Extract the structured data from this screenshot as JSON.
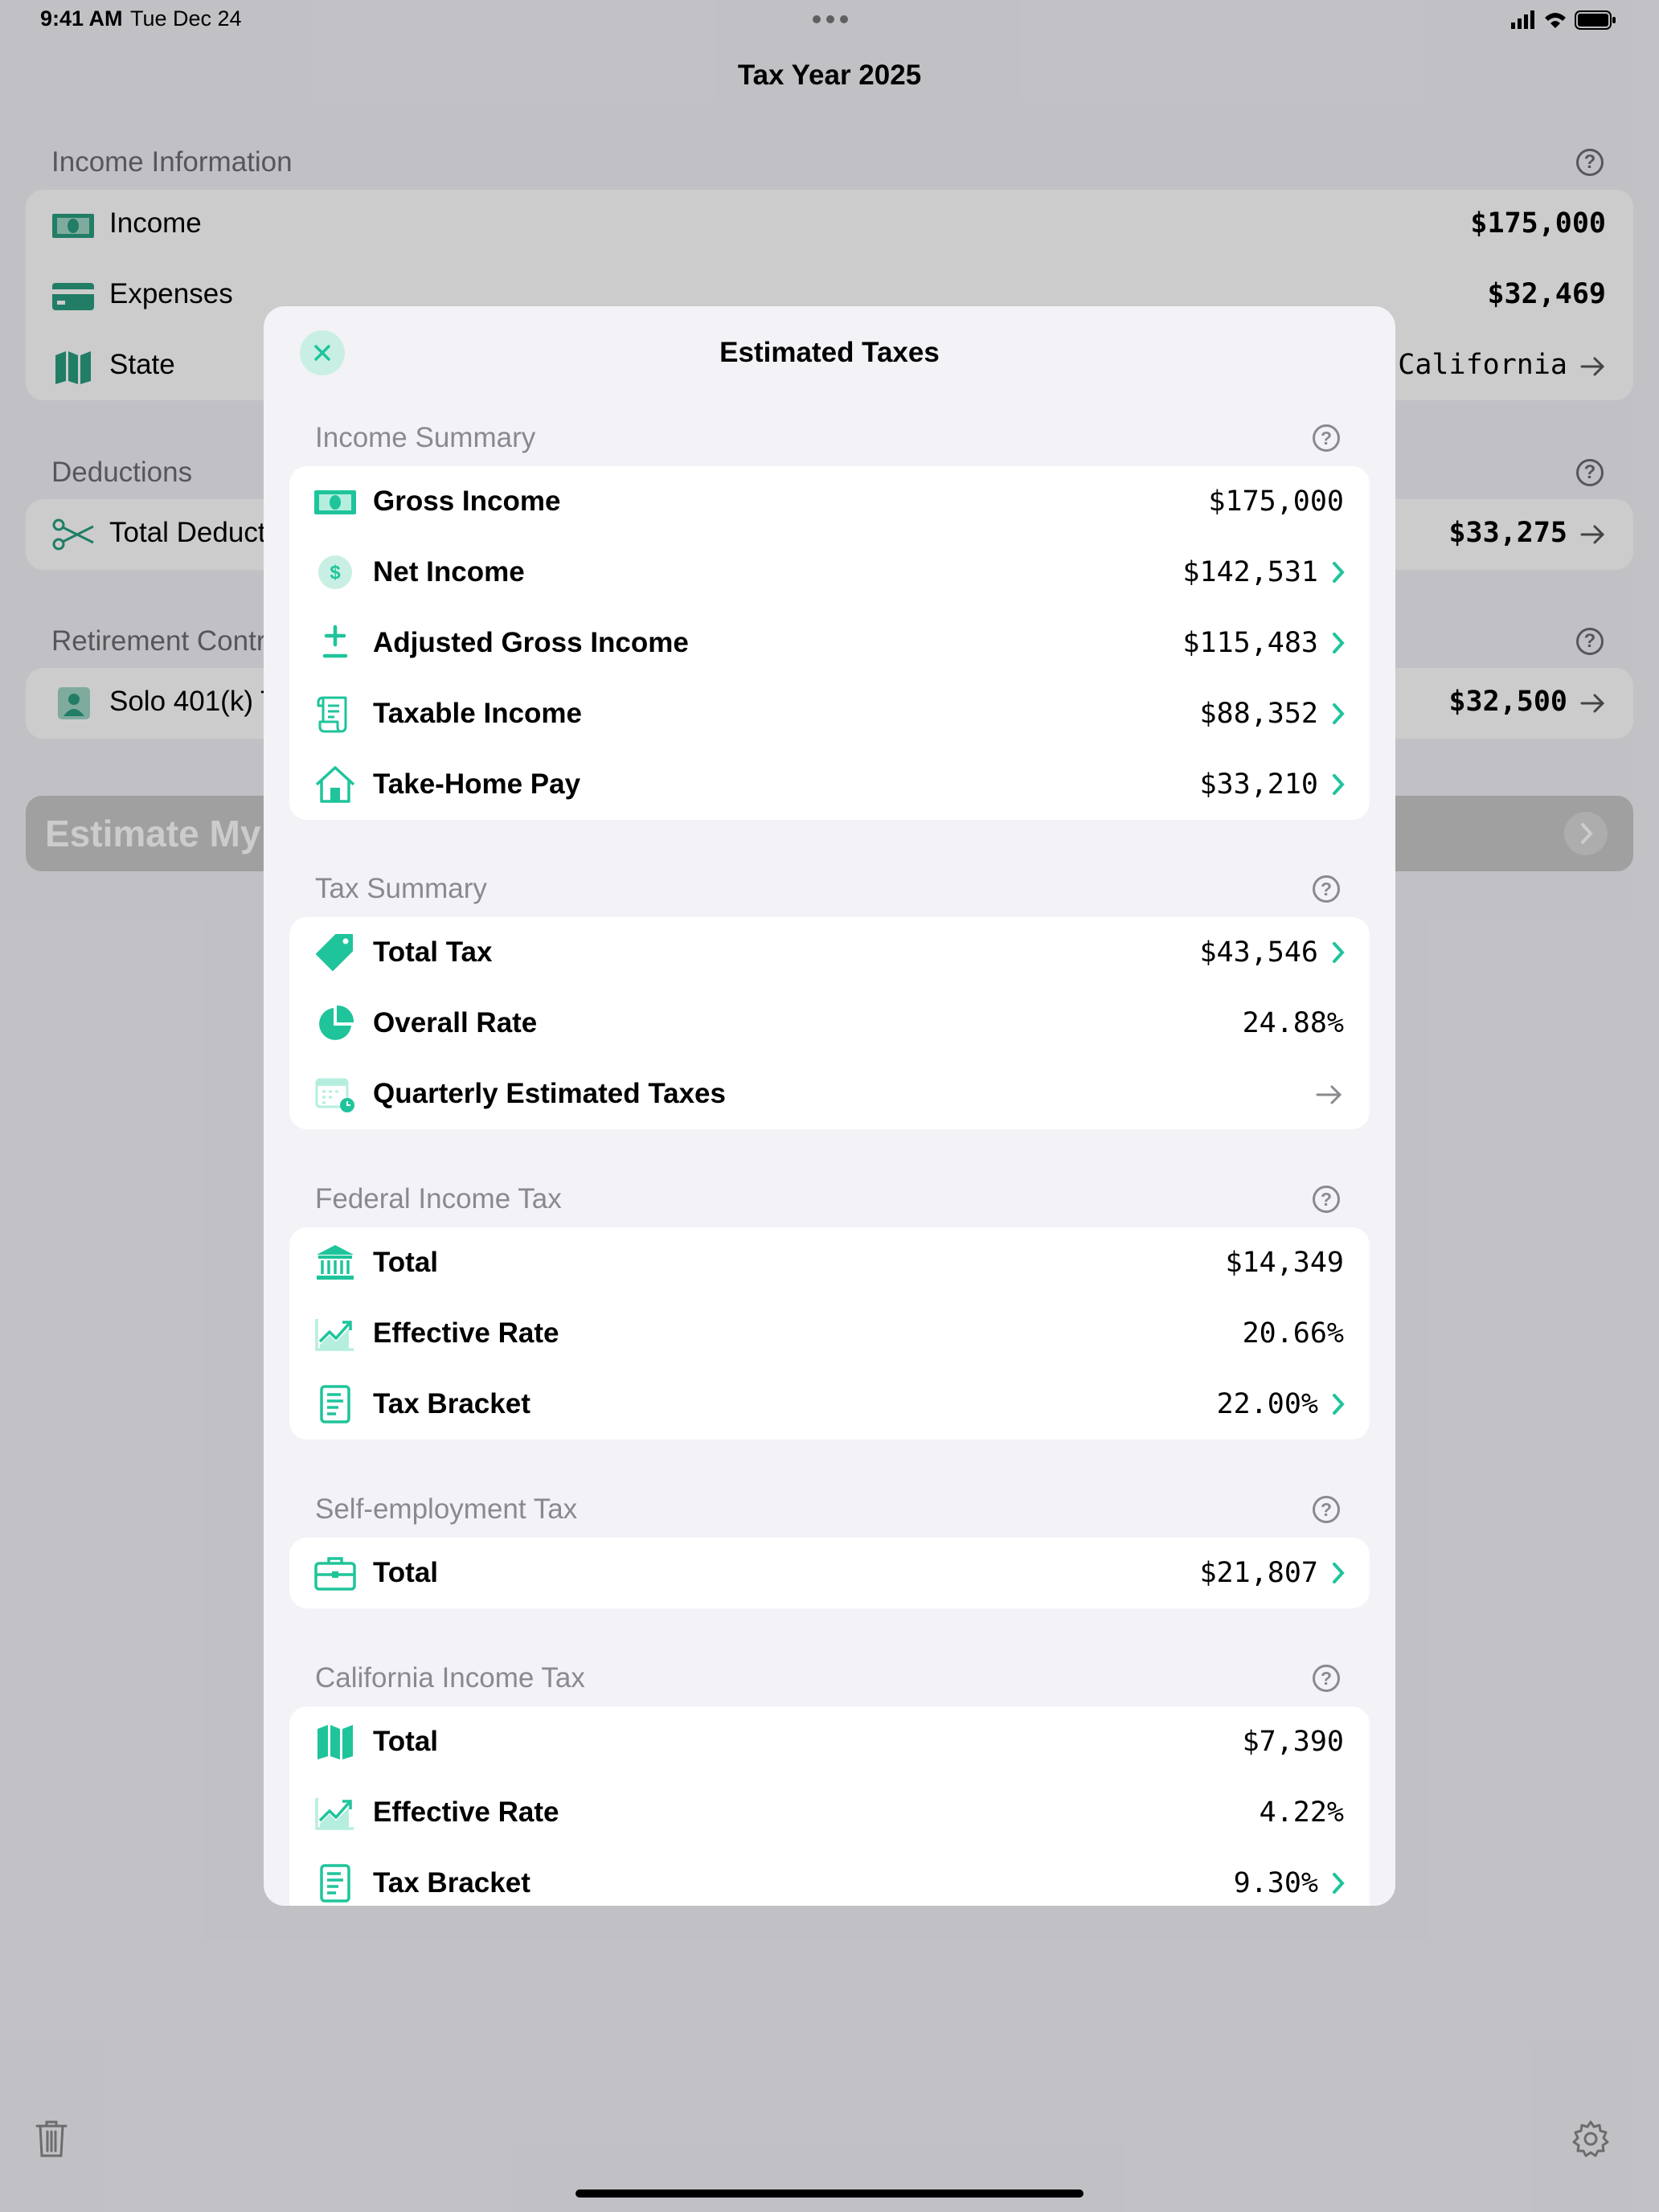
{
  "status_bar": {
    "time": "9:41 AM",
    "date": "Tue Dec 24"
  },
  "nav": {
    "title": "Tax Year 2025"
  },
  "background": {
    "income_header": "Income Information",
    "income_rows": [
      {
        "label": "Income",
        "value": "$175,000"
      },
      {
        "label": "Expenses",
        "value": "$32,469"
      },
      {
        "label": "State",
        "value": "California"
      }
    ],
    "deductions_header": "Deductions",
    "deductions_row": {
      "label": "Total Deduct",
      "value": "$33,275"
    },
    "retirement_header": "Retirement Contr",
    "retirement_row": {
      "label": "Solo 401(k) T",
      "value": "$32,500"
    },
    "estimate_button": "Estimate My T"
  },
  "sheet": {
    "title": "Estimated Taxes",
    "income_summary": {
      "header": "Income Summary",
      "rows": [
        {
          "label": "Gross Income",
          "value": "$175,000",
          "icon": "cash-icon"
        },
        {
          "label": "Net Income",
          "value": "$142,531",
          "icon": "dollar-circle-icon"
        },
        {
          "label": "Adjusted Gross Income",
          "value": "$115,483",
          "icon": "plus-minus-icon"
        },
        {
          "label": "Taxable Income",
          "value": "$88,352",
          "icon": "scroll-icon"
        },
        {
          "label": "Take-Home Pay",
          "value": "$33,210",
          "icon": "house-icon"
        }
      ]
    },
    "tax_summary": {
      "header": "Tax Summary",
      "rows": [
        {
          "label": "Total Tax",
          "value": "$43,546",
          "icon": "tag-icon"
        },
        {
          "label": "Overall Rate",
          "value": "24.88%",
          "icon": "pie-icon"
        },
        {
          "label": "Quarterly Estimated Taxes",
          "value": "",
          "icon": "calendar-clock-icon"
        }
      ]
    },
    "federal": {
      "header": "Federal Income Tax",
      "rows": [
        {
          "label": "Total",
          "value": "$14,349",
          "icon": "bank-icon"
        },
        {
          "label": "Effective Rate",
          "value": "20.66%",
          "icon": "trend-chart-icon"
        },
        {
          "label": "Tax Bracket",
          "value": "22.00%",
          "icon": "document-icon"
        }
      ]
    },
    "self_employment": {
      "header": "Self-employment Tax",
      "rows": [
        {
          "label": "Total",
          "value": "$21,807",
          "icon": "briefcase-icon"
        }
      ]
    },
    "california": {
      "header": "California Income Tax",
      "rows": [
        {
          "label": "Total",
          "value": "$7,390",
          "icon": "map-icon"
        },
        {
          "label": "Effective Rate",
          "value": "4.22%",
          "icon": "trend-chart-icon"
        },
        {
          "label": "Tax Bracket",
          "value": "9.30%",
          "icon": "document-icon"
        }
      ]
    }
  },
  "colors": {
    "accent": "#1fc49b",
    "bg_accent": "#2a9d80",
    "group_bg": "#f2f2f7",
    "secondary_text": "#8a8a8e"
  }
}
